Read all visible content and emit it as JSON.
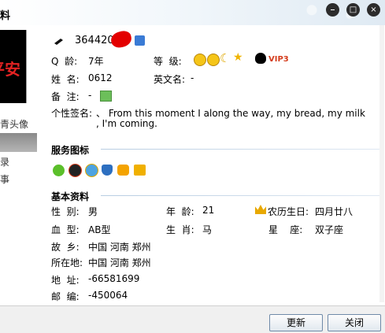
{
  "window": {
    "title": "料"
  },
  "sidebar": {
    "labels": [
      "青头像",
      "录",
      "事"
    ]
  },
  "profile": {
    "qq_number": "3644201",
    "rows": [
      {
        "label": "Q  龄:",
        "value": "7年"
      },
      {
        "label": "姓  名:",
        "value": "0612"
      },
      {
        "label": "备  注:",
        "value": "-"
      }
    ],
    "level_label": "等  级:",
    "english_name_label": "英文名:",
    "english_name_value": "-",
    "vip_badge": "VIP3",
    "signature_label": "个性签名:",
    "signature_line1": "、 From this moment I along the way, my bread, my milk",
    "signature_line2": ", I'm coming."
  },
  "services": {
    "title": "服务图标",
    "icons": [
      "green-chat-icon",
      "qq-penguin-icon",
      "qq-show-icon",
      "shield-icon",
      "pet-icon",
      "gift-icon"
    ]
  },
  "basic": {
    "title": "基本资料",
    "gender_label": "性  别:",
    "gender_value": "男",
    "age_label": "年  龄:",
    "age_value": "21",
    "lunar_label": "农历生日:",
    "lunar_value": "四月廿八",
    "blood_label": "血  型:",
    "blood_value": "AB型",
    "zodiac_label": "生  肖:",
    "zodiac_value": "马",
    "star_label": "星    座:",
    "star_value": "双子座",
    "hometown_label": "故  乡:",
    "hometown_value": "中国 河南 郑州",
    "location_label": "所在地:",
    "location_value": "中国 河南 郑州",
    "address_label": "地  址:",
    "address_value": "-66581699",
    "postal_label": "邮  编:",
    "postal_value": "-450064"
  },
  "buttons": {
    "refresh": "更新",
    "close": "关闭"
  },
  "colors": {
    "accent_rule": "#b8cde2",
    "vip_red": "#d43c1c"
  }
}
